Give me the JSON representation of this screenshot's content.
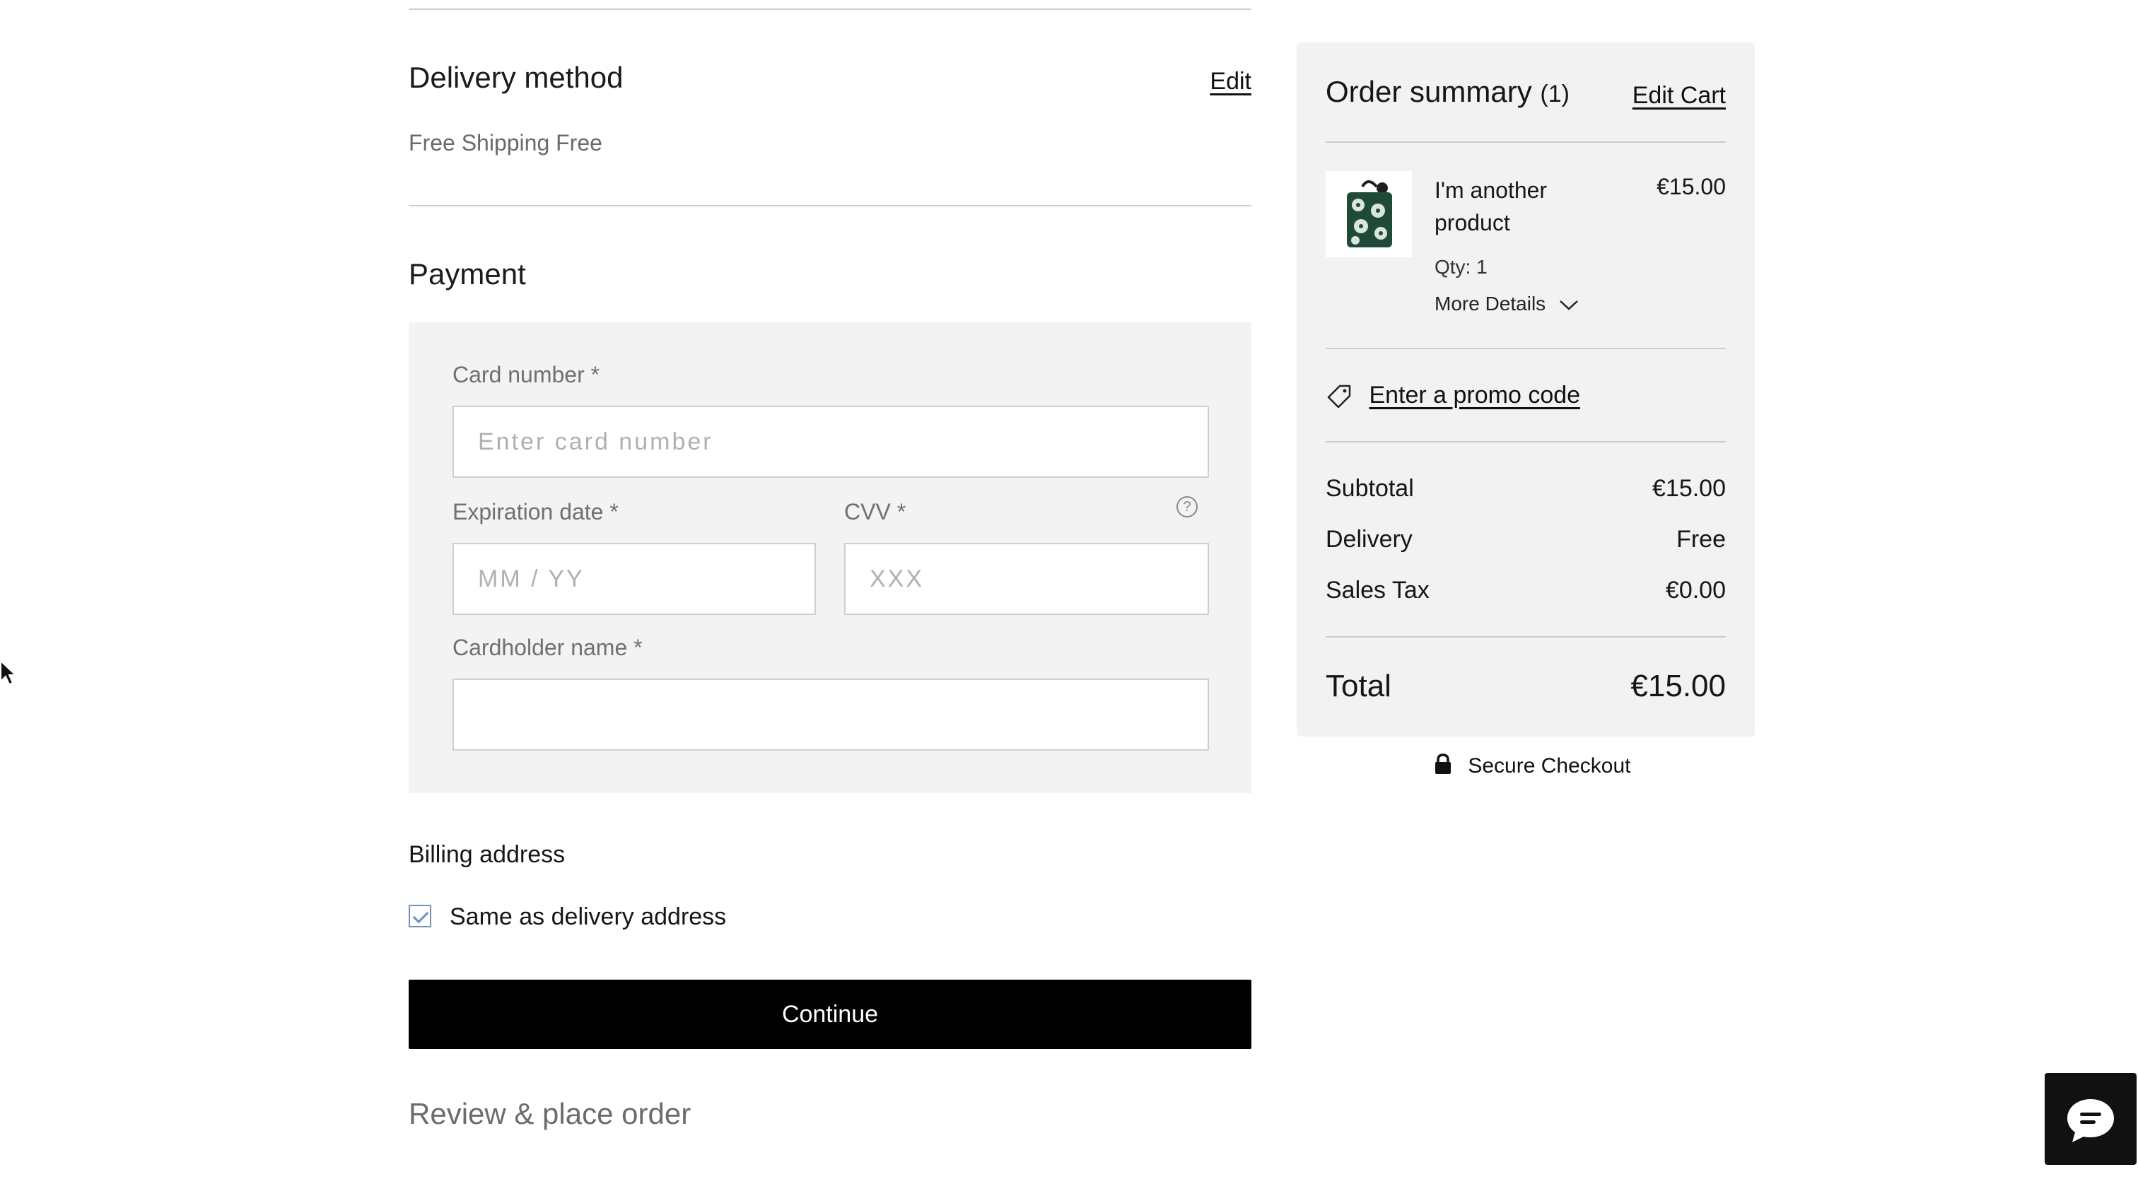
{
  "delivery": {
    "title": "Delivery method",
    "edit_label": "Edit",
    "method_text": "Free Shipping Free"
  },
  "payment": {
    "title": "Payment",
    "card_number_label": "Card number *",
    "card_number_placeholder": "Enter card number",
    "expiration_label": "Expiration date *",
    "expiration_placeholder": "MM / YY",
    "cvv_label": "CVV *",
    "cvv_placeholder": "XXX",
    "cardholder_label": "Cardholder name *",
    "cardholder_value": ""
  },
  "billing": {
    "title": "Billing address",
    "same_as_delivery_label": "Same as delivery address",
    "same_as_delivery_checked": true
  },
  "continue_label": "Continue",
  "review_title": "Review & place order",
  "summary": {
    "title": "Order summary",
    "count": "(1)",
    "edit_cart_label": "Edit Cart",
    "item": {
      "name_line1": "I'm another",
      "name_line2": "product",
      "price": "€15.00",
      "qty": "Qty: 1",
      "more_details": "More Details"
    },
    "promo_label": "Enter a promo code",
    "subtotal_label": "Subtotal",
    "subtotal_value": "€15.00",
    "delivery_label": "Delivery",
    "delivery_value": "Free",
    "tax_label": "Sales Tax",
    "tax_value": "€0.00",
    "total_label": "Total",
    "total_value": "€15.00"
  },
  "secure_checkout_label": "Secure Checkout",
  "icons": {
    "help": "question-circle-icon",
    "promo": "tag-icon",
    "lock": "lock-icon",
    "chevron": "chevron-down-icon",
    "chat": "chat-bubble-icon",
    "cursor": "mouse-pointer-icon"
  },
  "colors": {
    "button_bg": "#000000",
    "summary_bg": "#f2f2f2",
    "payment_bg": "#f3f3f3",
    "checkbox_accent": "#6f8ebb"
  }
}
